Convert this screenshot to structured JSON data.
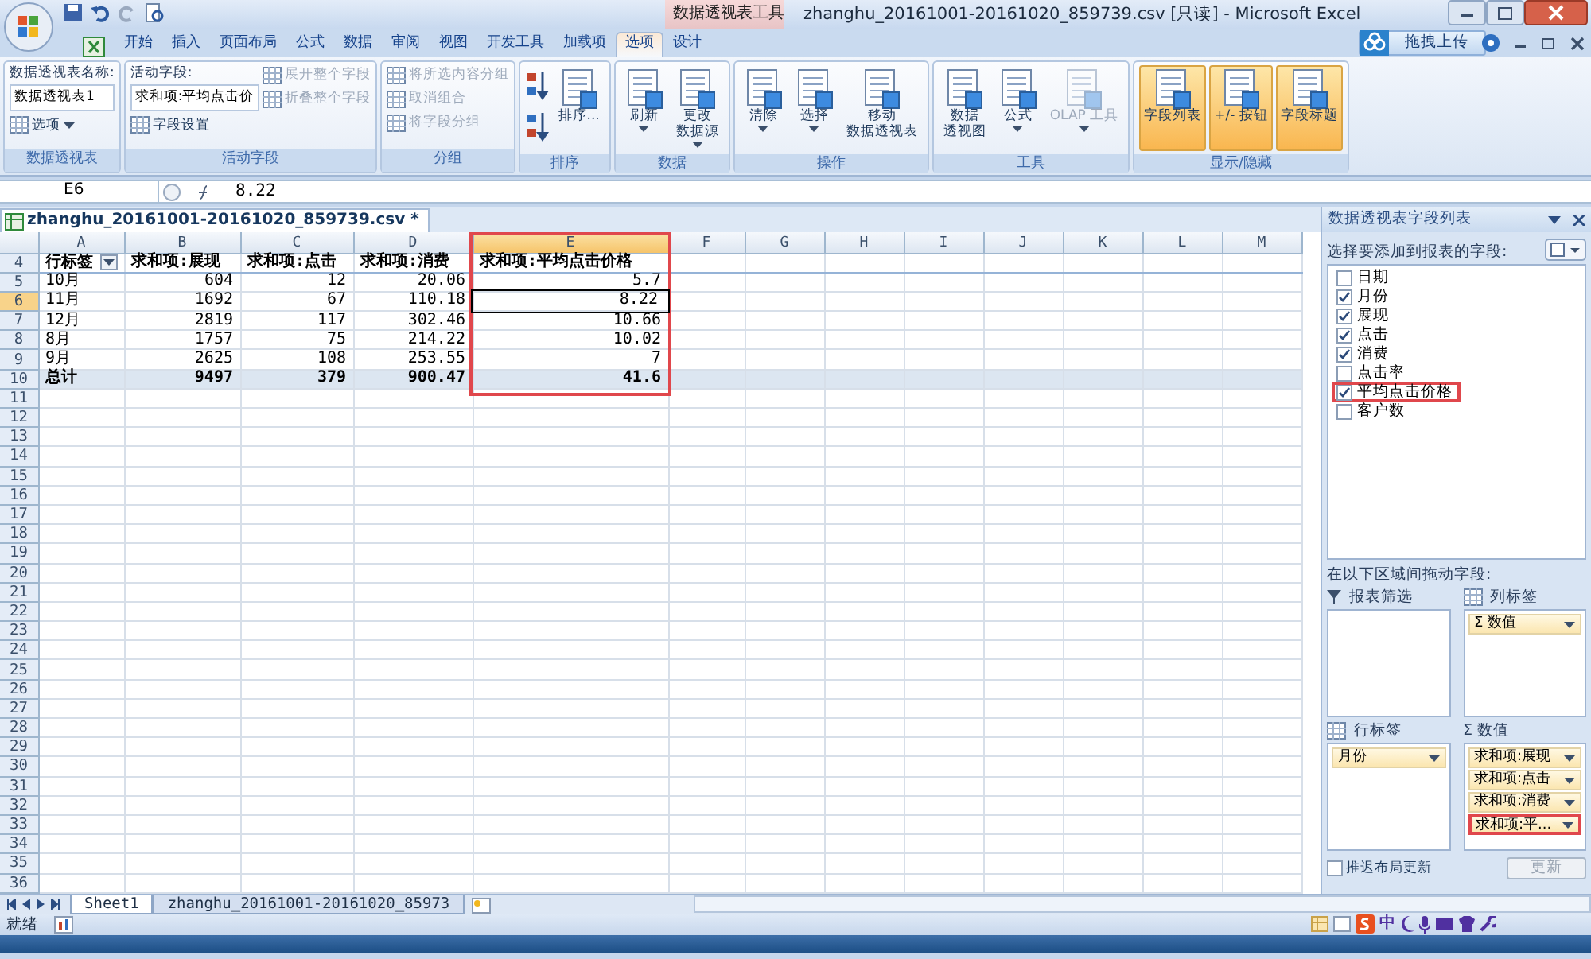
{
  "title_bar": {
    "context_label": "数据透视表工具",
    "title": "zhanghu_20161001-20161020_859739.csv  [只读] - Microsoft Excel"
  },
  "ribbon_tabs": [
    {
      "label": "开始",
      "selected": false
    },
    {
      "label": "插入",
      "selected": false
    },
    {
      "label": "页面布局",
      "selected": false
    },
    {
      "label": "公式",
      "selected": false
    },
    {
      "label": "数据",
      "selected": false
    },
    {
      "label": "审阅",
      "selected": false
    },
    {
      "label": "视图",
      "selected": false
    },
    {
      "label": "开发工具",
      "selected": false
    },
    {
      "label": "加载项",
      "selected": false
    },
    {
      "label": "选项",
      "selected": true
    },
    {
      "label": "设计",
      "selected": false
    }
  ],
  "upload_button": {
    "label": "拖拽上传"
  },
  "ribbon_groups": [
    {
      "label": "数据透视表",
      "columns": [
        [
          {
            "kind": "caption",
            "label": "数据透视表名称:"
          },
          {
            "kind": "field",
            "value": "数据透视表1"
          },
          {
            "kind": "small",
            "label": "选项",
            "dropdown": true,
            "disabled": false
          }
        ]
      ]
    },
    {
      "label": "活动字段",
      "columns": [
        [
          {
            "kind": "caption",
            "label": "活动字段:"
          },
          {
            "kind": "field",
            "value": "求和项:平均点击价"
          },
          {
            "kind": "small",
            "label": "字段设置",
            "dropdown": false,
            "disabled": false
          }
        ],
        [
          {
            "kind": "small",
            "label": "展开整个字段",
            "dropdown": false,
            "disabled": true
          },
          {
            "kind": "small",
            "label": "折叠整个字段",
            "dropdown": false,
            "disabled": true
          }
        ]
      ]
    },
    {
      "label": "分组",
      "columns": [
        [
          {
            "kind": "small",
            "label": "将所选内容分组",
            "dropdown": false,
            "disabled": true
          },
          {
            "kind": "small",
            "label": "取消组合",
            "dropdown": false,
            "disabled": true
          },
          {
            "kind": "small",
            "label": "将字段分组",
            "dropdown": false,
            "disabled": true
          }
        ]
      ]
    },
    {
      "label": "排序",
      "columns": [
        [
          {
            "kind": "icon_button",
            "disabled": false
          },
          {
            "kind": "icon_button",
            "disabled": false
          }
        ],
        [
          {
            "kind": "large",
            "label": "排序...",
            "dropdown": false,
            "disabled": false,
            "selected": false
          }
        ]
      ]
    },
    {
      "label": "数据",
      "columns": [
        [
          {
            "kind": "large",
            "label": "刷新",
            "dropdown": true,
            "disabled": false,
            "selected": false
          }
        ],
        [
          {
            "kind": "large",
            "lines": [
              "更改",
              "数据源"
            ],
            "dropdown": true,
            "disabled": false,
            "selected": false
          }
        ]
      ]
    },
    {
      "label": "操作",
      "columns": [
        [
          {
            "kind": "large",
            "label": "清除",
            "dropdown": true,
            "disabled": false,
            "selected": false
          }
        ],
        [
          {
            "kind": "large",
            "label": "选择",
            "dropdown": true,
            "disabled": false,
            "selected": false
          }
        ],
        [
          {
            "kind": "large",
            "lines": [
              "移动",
              "数据透视表"
            ],
            "dropdown": false,
            "disabled": false,
            "selected": false
          }
        ]
      ]
    },
    {
      "label": "工具",
      "columns": [
        [
          {
            "kind": "large",
            "lines": [
              "数据",
              "透视图"
            ],
            "dropdown": false,
            "disabled": false,
            "selected": false
          }
        ],
        [
          {
            "kind": "large",
            "label": "公式",
            "dropdown": true,
            "disabled": false,
            "selected": false
          }
        ],
        [
          {
            "kind": "large",
            "label": "OLAP 工具",
            "dropdown": true,
            "disabled": true,
            "selected": false
          }
        ]
      ]
    },
    {
      "label": "显示/隐藏",
      "columns": [
        [
          {
            "kind": "large",
            "label": "字段列表",
            "dropdown": false,
            "disabled": false,
            "selected": true
          }
        ],
        [
          {
            "kind": "large",
            "label": "+/- 按钮",
            "dropdown": false,
            "disabled": false,
            "selected": true
          }
        ],
        [
          {
            "kind": "large",
            "label": "字段标题",
            "dropdown": false,
            "disabled": false,
            "selected": true
          }
        ]
      ]
    }
  ],
  "formula_bar": {
    "name_box": "E6",
    "formula": "8.22"
  },
  "workbook_tab": "zhanghu_20161001-20161020_859739.csv *",
  "grid": {
    "columns": [
      {
        "letter": "A",
        "selected": false,
        "annotated": false
      },
      {
        "letter": "B",
        "selected": false,
        "annotated": false
      },
      {
        "letter": "C",
        "selected": false,
        "annotated": false
      },
      {
        "letter": "D",
        "selected": false,
        "annotated": false
      },
      {
        "letter": "E",
        "selected": true,
        "annotated": true
      },
      {
        "letter": "F",
        "selected": false,
        "annotated": false
      },
      {
        "letter": "G",
        "selected": false,
        "annotated": false
      },
      {
        "letter": "H",
        "selected": false,
        "annotated": false
      },
      {
        "letter": "I",
        "selected": false,
        "annotated": false
      },
      {
        "letter": "J",
        "selected": false,
        "annotated": false
      },
      {
        "letter": "K",
        "selected": false,
        "annotated": false
      },
      {
        "letter": "L",
        "selected": false,
        "annotated": false
      },
      {
        "letter": "M",
        "selected": false,
        "annotated": false
      }
    ],
    "rows": [
      {
        "number": "4",
        "selected": false,
        "kind": "header",
        "cells": [
          "行标签",
          "求和项:展现",
          "求和项:点击",
          "求和项:消费",
          "求和项:平均点击价格"
        ]
      },
      {
        "number": "5",
        "selected": false,
        "kind": "data",
        "cells": [
          "10月",
          "604",
          "12",
          "20.06",
          "5.7"
        ]
      },
      {
        "number": "6",
        "selected": true,
        "kind": "data",
        "cells": [
          "11月",
          "1692",
          "67",
          "110.18",
          "8.22"
        ]
      },
      {
        "number": "7",
        "selected": false,
        "kind": "data",
        "cells": [
          "12月",
          "2819",
          "117",
          "302.46",
          "10.66"
        ]
      },
      {
        "number": "8",
        "selected": false,
        "kind": "data",
        "cells": [
          "8月",
          "1757",
          "75",
          "214.22",
          "10.02"
        ]
      },
      {
        "number": "9",
        "selected": false,
        "kind": "data",
        "cells": [
          "9月",
          "2625",
          "108",
          "253.55",
          "7"
        ]
      },
      {
        "number": "10",
        "selected": false,
        "kind": "total",
        "cells": [
          "总计",
          "9497",
          "379",
          "900.47",
          "41.6"
        ]
      },
      {
        "number": "11",
        "selected": false,
        "kind": "empty"
      },
      {
        "number": "12",
        "selected": false,
        "kind": "empty"
      },
      {
        "number": "13",
        "selected": false,
        "kind": "empty"
      },
      {
        "number": "14",
        "selected": false,
        "kind": "empty"
      },
      {
        "number": "15",
        "selected": false,
        "kind": "empty"
      },
      {
        "number": "16",
        "selected": false,
        "kind": "empty"
      },
      {
        "number": "17",
        "selected": false,
        "kind": "empty"
      },
      {
        "number": "18",
        "selected": false,
        "kind": "empty"
      },
      {
        "number": "19",
        "selected": false,
        "kind": "empty"
      },
      {
        "number": "20",
        "selected": false,
        "kind": "empty"
      },
      {
        "number": "21",
        "selected": false,
        "kind": "empty"
      },
      {
        "number": "22",
        "selected": false,
        "kind": "empty"
      },
      {
        "number": "23",
        "selected": false,
        "kind": "empty"
      },
      {
        "number": "24",
        "selected": false,
        "kind": "empty"
      },
      {
        "number": "25",
        "selected": false,
        "kind": "empty"
      },
      {
        "number": "26",
        "selected": false,
        "kind": "empty"
      },
      {
        "number": "27",
        "selected": false,
        "kind": "empty"
      },
      {
        "number": "28",
        "selected": false,
        "kind": "empty"
      },
      {
        "number": "29",
        "selected": false,
        "kind": "empty"
      },
      {
        "number": "30",
        "selected": false,
        "kind": "empty"
      },
      {
        "number": "31",
        "selected": false,
        "kind": "empty"
      },
      {
        "number": "32",
        "selected": false,
        "kind": "empty"
      },
      {
        "number": "33",
        "selected": false,
        "kind": "empty"
      },
      {
        "number": "34",
        "selected": false,
        "kind": "empty"
      },
      {
        "number": "35",
        "selected": false,
        "kind": "empty"
      },
      {
        "number": "36",
        "selected": false,
        "kind": "empty"
      }
    ]
  },
  "field_pane": {
    "title": "数据透视表字段列表",
    "prompt": "选择要添加到报表的字段:",
    "fields": [
      {
        "label": "日期",
        "checked": false,
        "highlighted": false
      },
      {
        "label": "月份",
        "checked": true,
        "highlighted": false
      },
      {
        "label": "展现",
        "checked": true,
        "highlighted": false
      },
      {
        "label": "点击",
        "checked": true,
        "highlighted": false
      },
      {
        "label": "消费",
        "checked": true,
        "highlighted": false
      },
      {
        "label": "点击率",
        "checked": false,
        "highlighted": false
      },
      {
        "label": "平均点击价格",
        "checked": true,
        "highlighted": true
      },
      {
        "label": "客户数",
        "checked": false,
        "highlighted": false
      }
    ],
    "areas_prompt": "在以下区域间拖动字段:",
    "areas": [
      {
        "label": "报表筛选",
        "kind": "filter"
      },
      {
        "label": "列标签",
        "kind": "columns",
        "items": [
          {
            "label": "Σ 数值",
            "highlighted": false
          }
        ]
      },
      {
        "label": "行标签",
        "kind": "rows",
        "items": [
          {
            "label": "月份",
            "highlighted": false
          }
        ]
      },
      {
        "label": "Σ  数值",
        "kind": "values",
        "items": [
          {
            "label": "求和项:展现",
            "highlighted": false
          },
          {
            "label": "求和项:点击",
            "highlighted": false
          },
          {
            "label": "求和项:消费",
            "highlighted": false
          },
          {
            "label": "求和项:平...",
            "highlighted": true
          }
        ]
      }
    ],
    "defer_update": {
      "label": "推迟布局更新",
      "checked": false
    },
    "update_button": {
      "label": "更新",
      "disabled": true
    }
  },
  "sheet_tabs": [
    {
      "label": "Sheet1",
      "selected": true
    },
    {
      "label": "zhanghu_20161001-20161020_85973",
      "selected": false
    }
  ],
  "status_bar": {
    "text": "就绪",
    "ime": "中"
  }
}
